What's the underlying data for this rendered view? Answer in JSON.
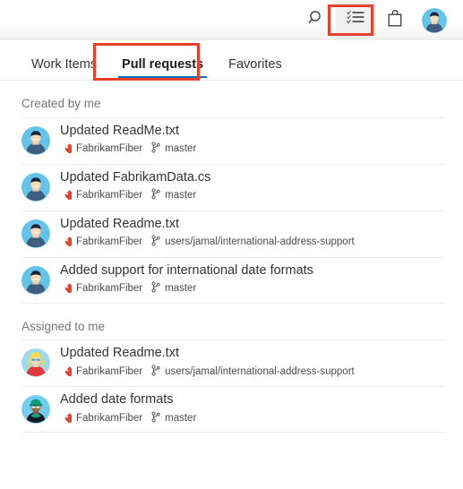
{
  "header": {
    "icons": [
      {
        "name": "search-icon",
        "label": "Search"
      },
      {
        "name": "list-icon",
        "label": "My work"
      },
      {
        "name": "shopping-bag-icon",
        "label": "Marketplace"
      },
      {
        "name": "user-avatar",
        "label": "User profile"
      }
    ]
  },
  "annotations": {
    "list_icon_box_color": "#e8402a",
    "pull_requests_tab_box_color": "#e8402a"
  },
  "tabs": [
    {
      "label": "Work Items",
      "active": false
    },
    {
      "label": "Pull requests",
      "active": true
    },
    {
      "label": "Favorites",
      "active": false
    }
  ],
  "accent": {
    "tab_underline": "#106ebe",
    "repo_icon": "#e8402a",
    "annotation": "#e8402a"
  },
  "sections": [
    {
      "title": "Created by me",
      "items": [
        {
          "title": "Updated ReadMe.txt",
          "repo": "FabrikamFiber",
          "branch": "master",
          "avatar": "avatar-male-dark-hair"
        },
        {
          "title": "Updated FabrikamData.cs",
          "repo": "FabrikamFiber",
          "branch": "master",
          "avatar": "avatar-male-dark-hair"
        },
        {
          "title": "Updated Readme.txt",
          "repo": "FabrikamFiber",
          "branch": "users/jamal/international-address-support",
          "avatar": "avatar-male-dark-hair"
        },
        {
          "title": "Added support for international date formats",
          "repo": "FabrikamFiber",
          "branch": "master",
          "avatar": "avatar-male-dark-hair"
        }
      ]
    },
    {
      "title": "Assigned to me",
      "items": [
        {
          "title": "Updated Readme.txt",
          "repo": "FabrikamFiber",
          "branch": "users/jamal/international-address-support",
          "avatar": "avatar-female-blonde"
        },
        {
          "title": "Added date formats",
          "repo": "FabrikamFiber",
          "branch": "master",
          "avatar": "avatar-person-cap"
        }
      ]
    }
  ]
}
